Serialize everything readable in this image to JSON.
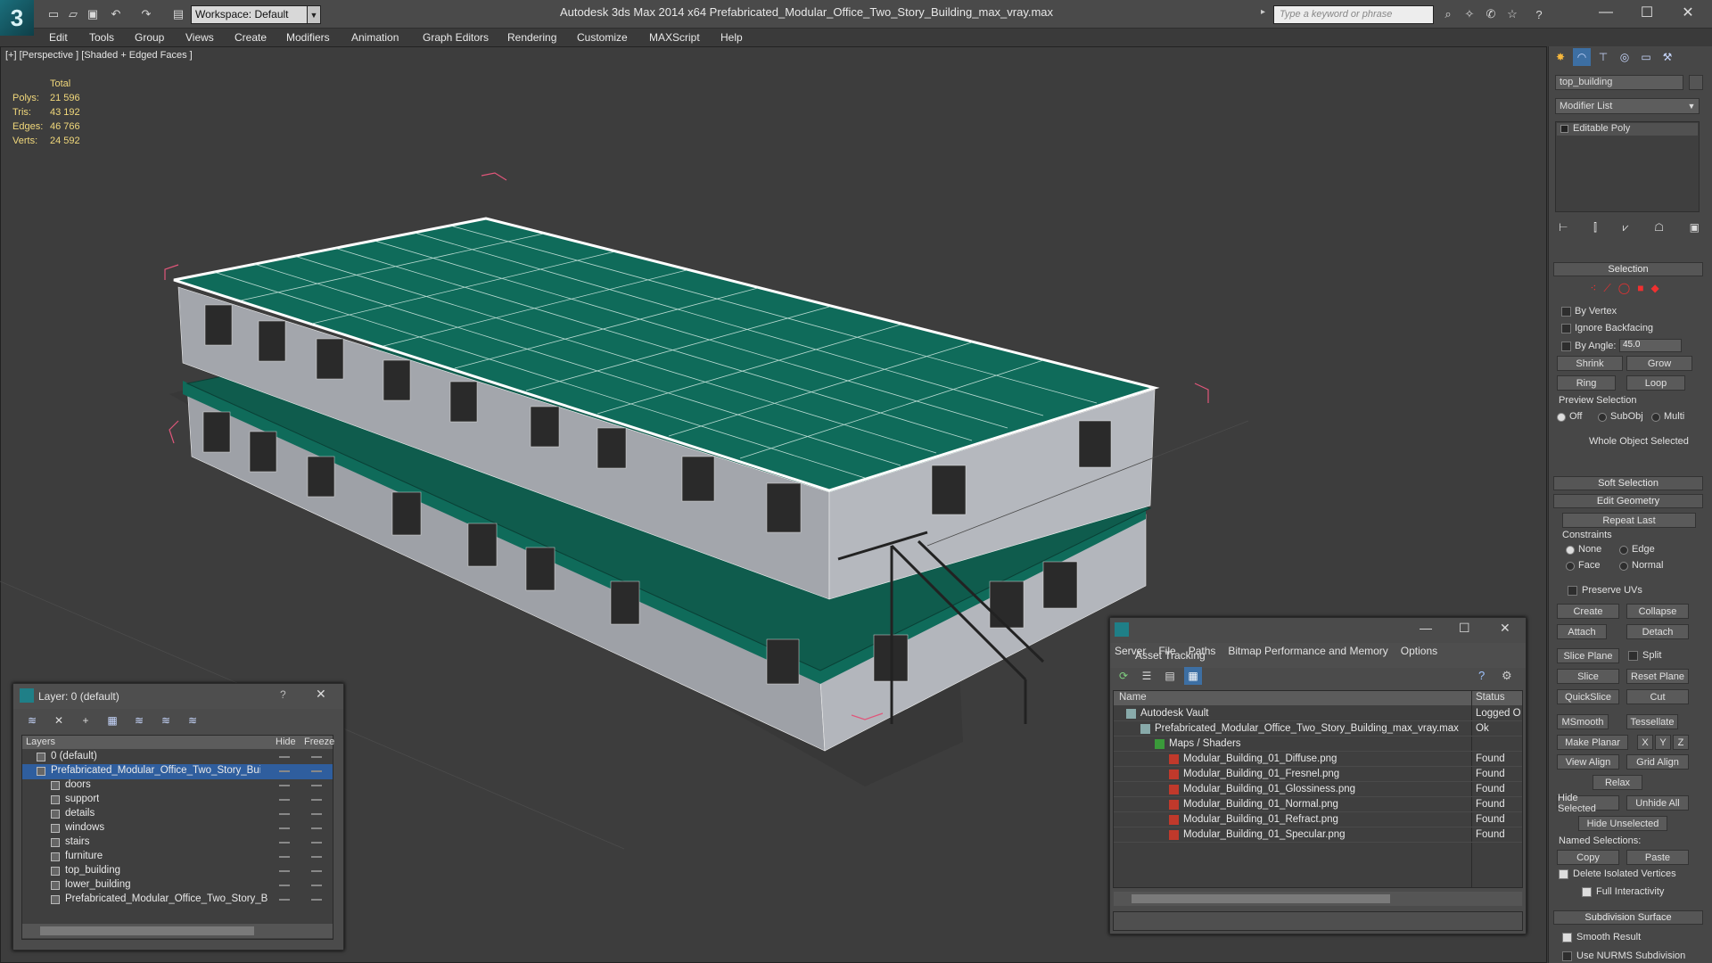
{
  "app": {
    "title": "Autodesk 3ds Max  2014 x64      Prefabricated_Modular_Office_Two_Story_Building_max_vray.max",
    "workspace": "Workspace: Default",
    "search_placeholder": "Type a keyword or phrase",
    "logo": "3"
  },
  "menu": [
    "Edit",
    "Tools",
    "Group",
    "Views",
    "Create",
    "Modifiers",
    "Animation",
    "Graph Editors",
    "Rendering",
    "Customize",
    "MAXScript",
    "Help"
  ],
  "viewport": {
    "label": "[+] [Perspective ] [Shaded + Edged Faces ]",
    "stats_header": "Total",
    "stats": [
      {
        "key": "Polys:",
        "value": "21 596"
      },
      {
        "key": "Tris:",
        "value": "43 192"
      },
      {
        "key": "Edges:",
        "value": "46 766"
      },
      {
        "key": "Verts:",
        "value": "24 592"
      }
    ]
  },
  "command_panel": {
    "object_name": "top_building",
    "modifier_list": "Modifier List",
    "stack_item": "Editable Poly",
    "selection_title": "Selection",
    "by_vertex": "By Vertex",
    "ignore_backfacing": "Ignore Backfacing",
    "by_angle": "By Angle:",
    "angle_value": "45.0",
    "shrink": "Shrink",
    "grow": "Grow",
    "ring": "Ring",
    "loop": "Loop",
    "preview_selection": "Preview Selection",
    "preview_off": "Off",
    "preview_subobj": "SubObj",
    "preview_multi": "Multi",
    "whole_object": "Whole Object Selected",
    "soft_selection": "Soft Selection",
    "edit_geometry": "Edit Geometry",
    "repeat_last": "Repeat Last",
    "constraints": "Constraints",
    "c_none": "None",
    "c_edge": "Edge",
    "c_face": "Face",
    "c_normal": "Normal",
    "preserve_uvs": "Preserve UVs",
    "create": "Create",
    "collapse": "Collapse",
    "attach": "Attach",
    "detach": "Detach",
    "slice_plane": "Slice Plane",
    "split": "Split",
    "slice": "Slice",
    "reset_plane": "Reset Plane",
    "quickslice": "QuickSlice",
    "cut": "Cut",
    "msmooth": "MSmooth",
    "tessellate": "Tessellate",
    "make_planar": "Make Planar",
    "x": "X",
    "y": "Y",
    "z": "Z",
    "view_align": "View Align",
    "grid_align": "Grid Align",
    "relax": "Relax",
    "hide_selected": "Hide Selected",
    "unhide_all": "Unhide All",
    "hide_unselected": "Hide Unselected",
    "named_selections": "Named Selections:",
    "copy": "Copy",
    "paste": "Paste",
    "delete_isolated": "Delete Isolated Vertices",
    "full_interactivity": "Full Interactivity",
    "subdivision_surface": "Subdivision Surface",
    "smooth_result": "Smooth Result",
    "use_nurms": "Use NURMS Subdivision"
  },
  "layer_window": {
    "title": "Layer: 0 (default)",
    "help": "?",
    "col_layers": "Layers",
    "col_hide": "Hide",
    "col_freeze": "Freeze",
    "rows": [
      {
        "name": "0 (default)",
        "level": 1,
        "selected": false
      },
      {
        "name": "Prefabricated_Modular_Office_Two_Story_Build",
        "level": 1,
        "selected": true
      },
      {
        "name": "doors",
        "level": 2,
        "selected": false
      },
      {
        "name": "support",
        "level": 2,
        "selected": false
      },
      {
        "name": "details",
        "level": 2,
        "selected": false
      },
      {
        "name": "windows",
        "level": 2,
        "selected": false
      },
      {
        "name": "stairs",
        "level": 2,
        "selected": false
      },
      {
        "name": "furniture",
        "level": 2,
        "selected": false
      },
      {
        "name": "top_building",
        "level": 2,
        "selected": false
      },
      {
        "name": "lower_building",
        "level": 2,
        "selected": false
      },
      {
        "name": "Prefabricated_Modular_Office_Two_Story_B",
        "level": 2,
        "selected": false
      }
    ]
  },
  "asset_window": {
    "title": "Asset Tracking",
    "menu": [
      "Server",
      "File",
      "Paths",
      "Bitmap Performance and Memory",
      "Options"
    ],
    "col_name": "Name",
    "col_status": "Status",
    "rows": [
      {
        "name": "Autodesk Vault",
        "status": "Logged O",
        "level": 0
      },
      {
        "name": "Prefabricated_Modular_Office_Two_Story_Building_max_vray.max",
        "status": "Ok",
        "level": 1
      },
      {
        "name": "Maps / Shaders",
        "status": "",
        "level": 2
      },
      {
        "name": "Modular_Building_01_Diffuse.png",
        "status": "Found",
        "level": 3
      },
      {
        "name": "Modular_Building_01_Fresnel.png",
        "status": "Found",
        "level": 3
      },
      {
        "name": "Modular_Building_01_Glossiness.png",
        "status": "Found",
        "level": 3
      },
      {
        "name": "Modular_Building_01_Normal.png",
        "status": "Found",
        "level": 3
      },
      {
        "name": "Modular_Building_01_Refract.png",
        "status": "Found",
        "level": 3
      },
      {
        "name": "Modular_Building_01_Specular.png",
        "status": "Found",
        "level": 3
      }
    ]
  },
  "colors": {
    "roof": "#0f6b5a",
    "wall": "#a9acb2",
    "selection_bracket": "#e0567a",
    "stats_text": "#f1d87b"
  }
}
